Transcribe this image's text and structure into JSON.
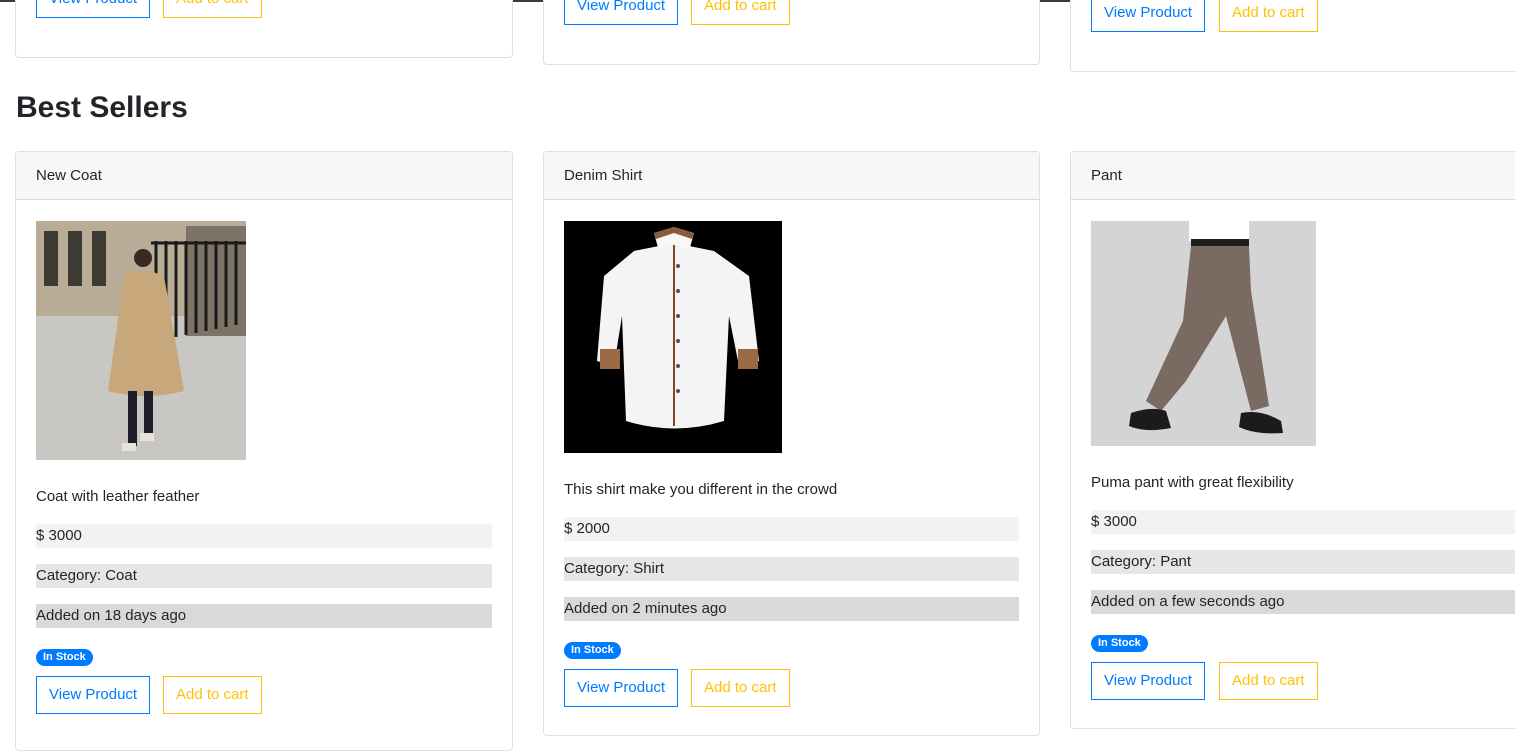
{
  "section_title": "Best Sellers",
  "buttons": {
    "view": "View Product",
    "cart": "Add to cart"
  },
  "badge_label": "In Stock",
  "colors": {
    "primary": "#007bff",
    "warning": "#ffc107"
  },
  "products": [
    {
      "name": "New Coat",
      "description": "Coat with leather feather",
      "price": "$ 3000",
      "category": "Category: Coat",
      "added": "Added on 18 days ago",
      "image": "woman-in-beige-trench-coat-photo"
    },
    {
      "name": "Denim Shirt",
      "description": "This shirt make you different in the crowd",
      "price": "$ 2000",
      "category": "Category: Shirt",
      "added": "Added on 2 minutes ago",
      "image": "white-shirt-on-black-photo"
    },
    {
      "name": "Pant",
      "description": "Puma pant with great flexibility",
      "price": "$ 3000",
      "category": "Category: Pant",
      "added": "Added on a few seconds ago",
      "image": "brown-trousers-photo"
    }
  ]
}
